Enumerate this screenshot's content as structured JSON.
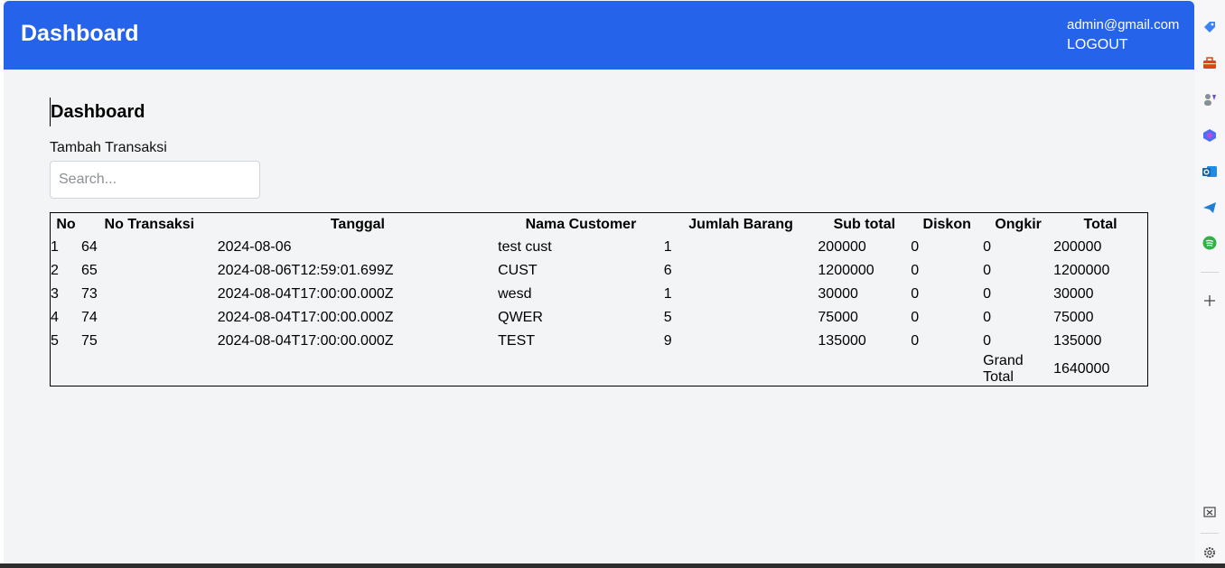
{
  "header": {
    "title": "Dashboard",
    "user_email": "admin@gmail.com",
    "logout_label": "LOGOUT"
  },
  "main": {
    "page_title": "Dashboard",
    "add_transaction_label": "Tambah Transaksi",
    "search_placeholder": "Search..."
  },
  "table": {
    "columns": [
      "No",
      "No Transaksi",
      "Tanggal",
      "Nama Customer",
      "Jumlah Barang",
      "Sub total",
      "Diskon",
      "Ongkir",
      "Total"
    ],
    "rows": [
      {
        "no": "1",
        "no_transaksi": "64",
        "tanggal": "2024-08-06",
        "customer": "test cust",
        "jumlah": "1",
        "subtotal": "200000",
        "diskon": "0",
        "ongkir": "0",
        "total": "200000"
      },
      {
        "no": "2",
        "no_transaksi": "65",
        "tanggal": "2024-08-06T12:59:01.699Z",
        "customer": "CUST",
        "jumlah": "6",
        "subtotal": "1200000",
        "diskon": "0",
        "ongkir": "0",
        "total": "1200000"
      },
      {
        "no": "3",
        "no_transaksi": "73",
        "tanggal": "2024-08-04T17:00:00.000Z",
        "customer": "wesd",
        "jumlah": "1",
        "subtotal": "30000",
        "diskon": "0",
        "ongkir": "0",
        "total": "30000"
      },
      {
        "no": "4",
        "no_transaksi": "74",
        "tanggal": "2024-08-04T17:00:00.000Z",
        "customer": "QWER",
        "jumlah": "5",
        "subtotal": "75000",
        "diskon": "0",
        "ongkir": "0",
        "total": "75000"
      },
      {
        "no": "5",
        "no_transaksi": "75",
        "tanggal": "2024-08-04T17:00:00.000Z",
        "customer": "TEST",
        "jumlah": "9",
        "subtotal": "135000",
        "diskon": "0",
        "ongkir": "0",
        "total": "135000"
      }
    ],
    "grand_total_label": "Grand Total",
    "grand_total_value": "1640000"
  },
  "sidebar": {
    "icons": [
      "tag-icon",
      "briefcase-icon",
      "people-icon",
      "copilot-icon",
      "outlook-icon",
      "telegram-icon",
      "spotify-icon",
      "add-icon",
      "screenshot-icon",
      "settings-icon"
    ]
  },
  "colors": {
    "brand": "#2563eb",
    "background": "#f3f4f6"
  }
}
